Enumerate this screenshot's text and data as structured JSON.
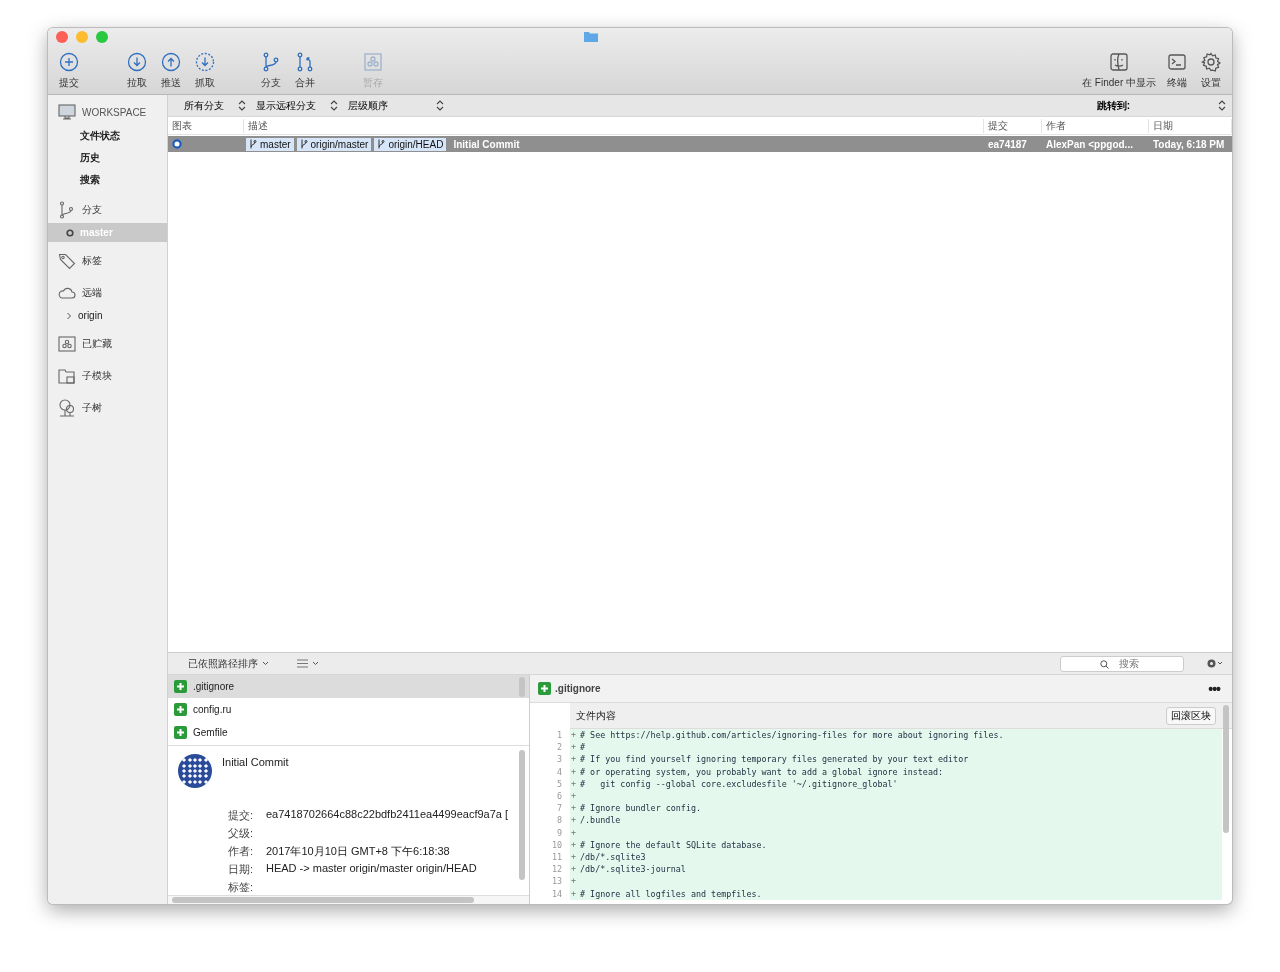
{
  "toolbar": {
    "left": [
      {
        "label": "提交",
        "disabled": false
      },
      {
        "label": "拉取",
        "disabled": false
      },
      {
        "label": "推送",
        "disabled": false
      },
      {
        "label": "抓取",
        "disabled": false
      },
      {
        "label": "分支",
        "disabled": false
      },
      {
        "label": "合并",
        "disabled": false
      },
      {
        "label": "暂存",
        "disabled": true
      }
    ],
    "right": [
      {
        "label": "在 Finder 中显示",
        "disabled": false
      },
      {
        "label": "终端",
        "disabled": false
      },
      {
        "label": "设置",
        "disabled": false
      }
    ]
  },
  "sidebar": {
    "sections": [
      {
        "label": "WORKSPACE",
        "children": [
          {
            "label": "文件状态",
            "selected": false
          },
          {
            "label": "历史",
            "selected": false
          },
          {
            "label": "搜索",
            "selected": false
          }
        ]
      },
      {
        "label": "分支",
        "children": [
          {
            "label": "master",
            "selected": true,
            "kind": "branch"
          }
        ]
      },
      {
        "label": "标签"
      },
      {
        "label": "远端",
        "children": [
          {
            "label": "origin",
            "selected": false,
            "kind": "remote",
            "expanded": false
          }
        ]
      },
      {
        "label": "已贮藏"
      },
      {
        "label": "子模块"
      },
      {
        "label": "子树"
      }
    ]
  },
  "filters": [
    {
      "label": "所有分支"
    },
    {
      "label": "显示远程分支"
    },
    {
      "label": "层级顺序"
    }
  ],
  "jump_to": {
    "label": "跳转到:"
  },
  "table": {
    "columns": [
      "图表",
      "描述",
      "提交",
      "作者",
      "日期"
    ],
    "rows": [
      {
        "selected": true,
        "refs": [
          "master",
          "origin/master",
          "origin/HEAD"
        ],
        "message": "Initial Commit",
        "commit": "ea74187",
        "author": "AlexPan <ppgod...",
        "date": "Today, 6:18 PM"
      }
    ]
  },
  "files_toolbar": {
    "sort": "已依照路径排序"
  },
  "search": {
    "placeholder": "搜索"
  },
  "files": [
    {
      "name": ".gitignore",
      "selected": true
    },
    {
      "name": "config.ru",
      "selected": false
    },
    {
      "name": "Gemfile",
      "selected": false
    }
  ],
  "commit_details": {
    "message": "Initial Commit",
    "fields": [
      {
        "label": "提交:",
        "value": "ea7418702664c88c22bdfb2411ea4499eacf9a7a ["
      },
      {
        "label": "父级:"
      },
      {
        "label": "作者:",
        "value": "2017年10月10日 GMT+8 下午6:18:38"
      },
      {
        "label": "日期:",
        "value": "HEAD -> master origin/master origin/HEAD"
      },
      {
        "label": "标签:"
      }
    ]
  },
  "diff": {
    "file": ".gitignore",
    "more": "•••",
    "hunk_title": "文件内容",
    "hunk_button": "回滚区块",
    "lines": [
      {
        "num": "1",
        "sign": "+",
        "text": "# See https://help.github.com/articles/ignoring-files for more about ignoring files."
      },
      {
        "num": "2",
        "sign": "+",
        "text": "#"
      },
      {
        "num": "3",
        "sign": "+",
        "text": "# If you find yourself ignoring temporary files generated by your text editor"
      },
      {
        "num": "4",
        "sign": "+",
        "text": "# or operating system, you probably want to add a global ignore instead:"
      },
      {
        "num": "5",
        "sign": "+",
        "text": "#   git config --global core.excludesfile '~/.gitignore_global'"
      },
      {
        "num": "6",
        "sign": "+"
      },
      {
        "num": "7",
        "sign": "+",
        "text": "# Ignore bundler config."
      },
      {
        "num": "8",
        "sign": "+",
        "text": "/.bundle"
      },
      {
        "num": "9",
        "sign": "+"
      },
      {
        "num": "10",
        "sign": "+",
        "text": "# Ignore the default SQLite database."
      },
      {
        "num": "11",
        "sign": "+",
        "text": "/db/*.sqlite3"
      },
      {
        "num": "12",
        "sign": "+",
        "text": "/db/*.sqlite3-journal"
      },
      {
        "num": "13",
        "sign": "+"
      },
      {
        "num": "14",
        "sign": "+",
        "text": "# Ignore all logfiles and tempfiles."
      }
    ]
  }
}
